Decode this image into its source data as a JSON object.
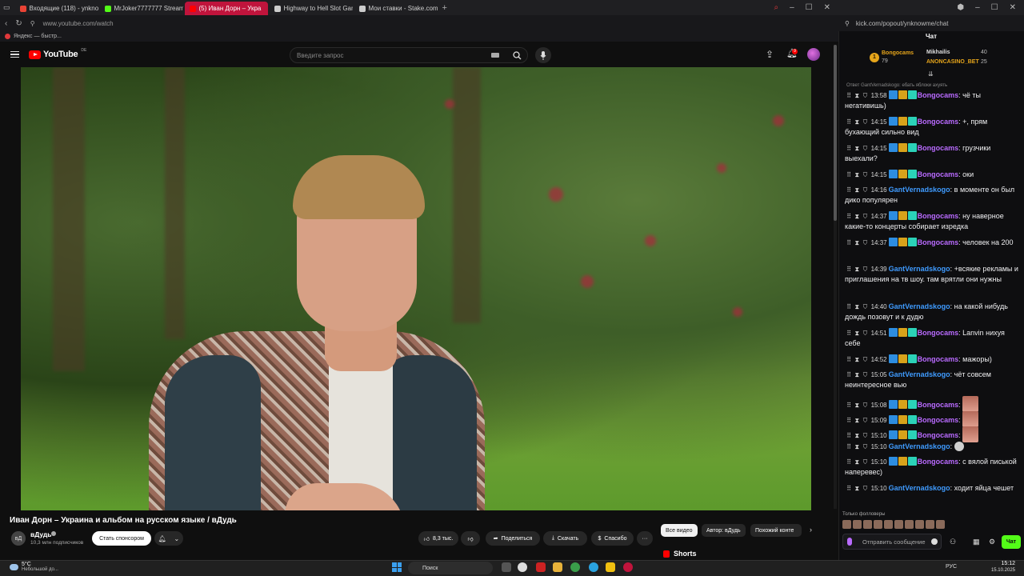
{
  "browser": {
    "tabs": [
      {
        "label": "Входящие (118) - ynkno",
        "color": "#ea4335"
      },
      {
        "label": "MrJoker7777777 Stream",
        "color": "#53fc18"
      },
      {
        "label": "(5) Иван Дорн – Укра",
        "color": "#ff0000",
        "active": true
      },
      {
        "label": "Highway to Hell Slot Gam",
        "color": "#cccccc"
      },
      {
        "label": "Мои ставки - Stake.com",
        "color": "#cccccc"
      }
    ],
    "new_tab": "+",
    "url": "www.youtube.com/watch",
    "bookmark": "Яндекс — быстр..."
  },
  "youtube": {
    "logo": "YouTube",
    "region": "DE",
    "search_placeholder": "Введите запрос",
    "notification_count": "9",
    "video_title": "Иван Дорн – Украина и альбом на русском языке / вДудь",
    "channel": {
      "name": "вДудь",
      "subscribers": "10,3 млн подписчиков",
      "avatar_text": "вД"
    },
    "sponsor_label": "Стать спонсором",
    "likes": "8,3 тыс.",
    "share_label": "Поделиться",
    "download_label": "Скачать",
    "thanks_label": "Спасибо",
    "more_label": "···",
    "filters": [
      "Все видео",
      "Автор: вДудь",
      "Похожий конте"
    ],
    "shorts_label": "Shorts"
  },
  "chat": {
    "url": "kick.com/popout/ynknowme/chat",
    "title": "Чат",
    "leaderboard": [
      {
        "name": "Bongocams",
        "count": "79",
        "color": "#e6a51b"
      },
      {
        "name": "Mikhailis",
        "count": "40",
        "color": "#dddddd"
      },
      {
        "name": "ANONCASINO_BET",
        "count": "25",
        "color": "#e6a51b"
      }
    ],
    "reply_note": "Ответ GantVernadskogo: ебать яблоки ахуять",
    "messages": [
      {
        "time": "13:58",
        "user": "Bongocams",
        "badges": true,
        "text": "чё ты негативишь)"
      },
      {
        "time": "14:15",
        "user": "Bongocams",
        "badges": true,
        "text": "+, прям бухающий сильно вид"
      },
      {
        "time": "14:15",
        "user": "Bongocams",
        "badges": true,
        "text": "грузчики выехали?"
      },
      {
        "time": "14:15",
        "user": "Bongocams",
        "badges": true,
        "text": "оки"
      },
      {
        "time": "14:16",
        "user": "GantVernadskogo",
        "badges": false,
        "text": "в моменте он был дико популярен"
      },
      {
        "time": "14:37",
        "user": "Bongocams",
        "badges": true,
        "text": "ну наверное какие-то концерты собирает изредка"
      },
      {
        "time": "14:37",
        "user": "Bongocams",
        "badges": true,
        "text": "человек на 200"
      },
      {
        "time": "14:39",
        "user": "GantVernadskogo",
        "badges": false,
        "text": "+всякие рекламы и приглашения на тв шоу. там врятли они нужны"
      },
      {
        "time": "14:40",
        "user": "GantVernadskogo",
        "badges": false,
        "text": "на какой нибудь дождь позовут и к дудю"
      },
      {
        "time": "14:51",
        "user": "Bongocams",
        "badges": true,
        "text": "Lanvin нихуя себе"
      },
      {
        "time": "14:52",
        "user": "Bongocams",
        "badges": true,
        "text": "мажоры)"
      },
      {
        "time": "15:05",
        "user": "GantVernadskogo",
        "badges": false,
        "text": "чёт совсем неинтересное вью"
      },
      {
        "time": "15:08",
        "user": "Bongocams",
        "badges": true,
        "text": "",
        "emote": "big"
      },
      {
        "time": "15:09",
        "user": "Bongocams",
        "badges": true,
        "text": "",
        "emote": "big"
      },
      {
        "time": "15:10",
        "user": "Bongocams",
        "badges": true,
        "text": "",
        "emote": "big"
      },
      {
        "time": "15:10",
        "user": "GantVernadskogo",
        "badges": false,
        "text": "",
        "emote": "small"
      },
      {
        "time": "15:10",
        "user": "Bongocams",
        "badges": true,
        "text": "с вялой писькой наперевес)"
      },
      {
        "time": "15:10",
        "user": "GantVernadskogo",
        "badges": false,
        "text": "ходит яйца чешет"
      }
    ],
    "followers_note": "Только фолловеры",
    "input_placeholder": "Отправить сообщение",
    "send_label": "Чат"
  },
  "taskbar": {
    "temperature": "5°C",
    "weather": "Небольшой до...",
    "search_label": "Поиск",
    "lang": "РУС",
    "time": "15:12",
    "date": "15.10.2025"
  }
}
